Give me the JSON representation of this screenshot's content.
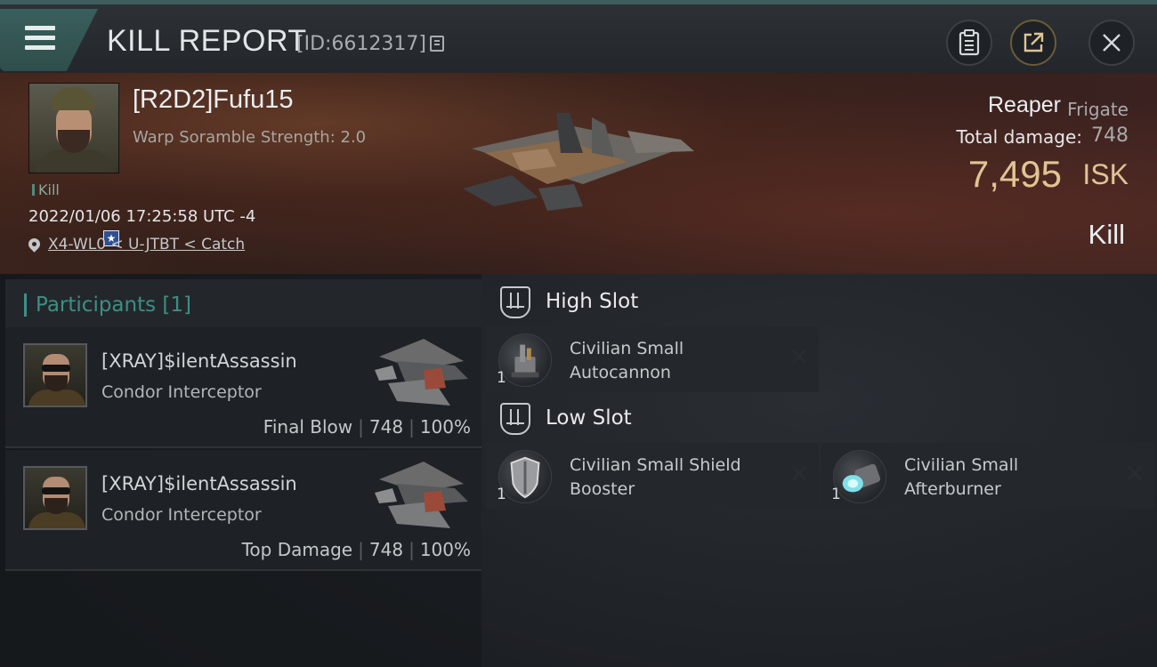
{
  "header": {
    "title": "KILL REPORT",
    "report_id": "[ID:6612317]"
  },
  "victim": {
    "name": "[R2D2]Fufu15",
    "scramble": "Warp Soramble Strength: 2.0",
    "kill_tag": "Kill",
    "timestamp": "2022/01/06 17:25:58 UTC -4",
    "location": "X4-WL0 < U-JTBT < Catch",
    "rank_badge": "★",
    "ship_name": "Reaper",
    "ship_class": "Frigate",
    "total_damage_label": "Total damage:",
    "total_damage": "748",
    "isk_value": "7,495",
    "isk_unit": "ISK",
    "kill_type": "Kill"
  },
  "participants": {
    "label": "Participants [1]",
    "rows": [
      {
        "name": "[XRAY]$ilentAssassin",
        "ship": "Condor Interceptor",
        "role": "Final Blow",
        "damage": "748",
        "percent": "100%"
      },
      {
        "name": "[XRAY]$ilentAssassin",
        "ship": "Condor Interceptor",
        "role": "Top Damage",
        "damage": "748",
        "percent": "100%"
      }
    ]
  },
  "fitting": {
    "high_slot_label": "High Slot",
    "low_slot_label": "Low Slot",
    "high": [
      {
        "name": "Civilian Small Autocannon",
        "qty": "1",
        "icon": "autocannon-icon"
      }
    ],
    "low": [
      {
        "name": "Civilian Small Shield Booster",
        "qty": "1",
        "icon": "shield-booster-icon"
      },
      {
        "name": "Civilian Small Afterburner",
        "qty": "1",
        "icon": "afterburner-icon"
      }
    ]
  },
  "colors": {
    "accent_teal": "#3c8f86",
    "isk_gold": "#e0c493",
    "menu_teal": "#3a5f5c"
  }
}
